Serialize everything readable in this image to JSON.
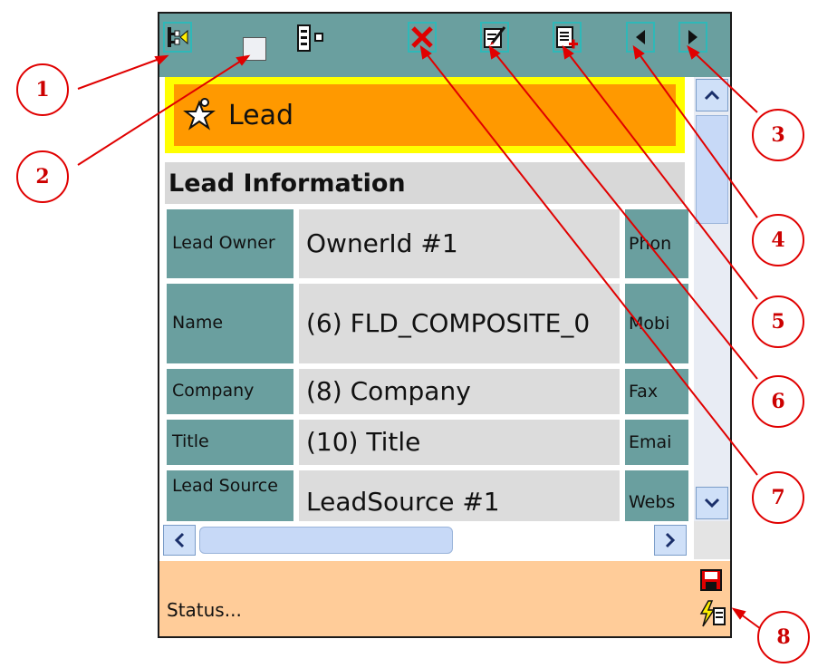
{
  "toolbar": {
    "buttons": [
      {
        "icon": "tree-collapse-icon"
      },
      {
        "icon": "checkbox-icon"
      },
      {
        "icon": "list-expand-icon"
      },
      {
        "icon": "delete-icon"
      },
      {
        "icon": "edit-record-icon"
      },
      {
        "icon": "new-record-icon"
      },
      {
        "icon": "previous-icon"
      },
      {
        "icon": "next-icon"
      }
    ]
  },
  "header": {
    "title": "Lead"
  },
  "section": {
    "title": "Lead Information"
  },
  "rows": [
    {
      "label": "Lead Owner",
      "value": "OwnerId #1",
      "label2": "Phon"
    },
    {
      "label": "Name",
      "value": "(6) FLD_COMPOSITE_0",
      "label2": "Mobi"
    },
    {
      "label": "Company",
      "value": "(8) Company",
      "label2": "Fax"
    },
    {
      "label": "Title",
      "value": "(10) Title",
      "label2": "Emai"
    },
    {
      "label": "Lead Source",
      "value": "LeadSource #1",
      "label2": "Webs"
    }
  ],
  "status": {
    "text": "Status..."
  },
  "callouts": [
    "1",
    "2",
    "3",
    "4",
    "5",
    "6",
    "7",
    "8"
  ],
  "colors": {
    "toolbar": "#6a9f9f",
    "header": "#ff9900",
    "header_border": "#ffff00",
    "status": "#ffcc99",
    "callout": "#e00000"
  }
}
